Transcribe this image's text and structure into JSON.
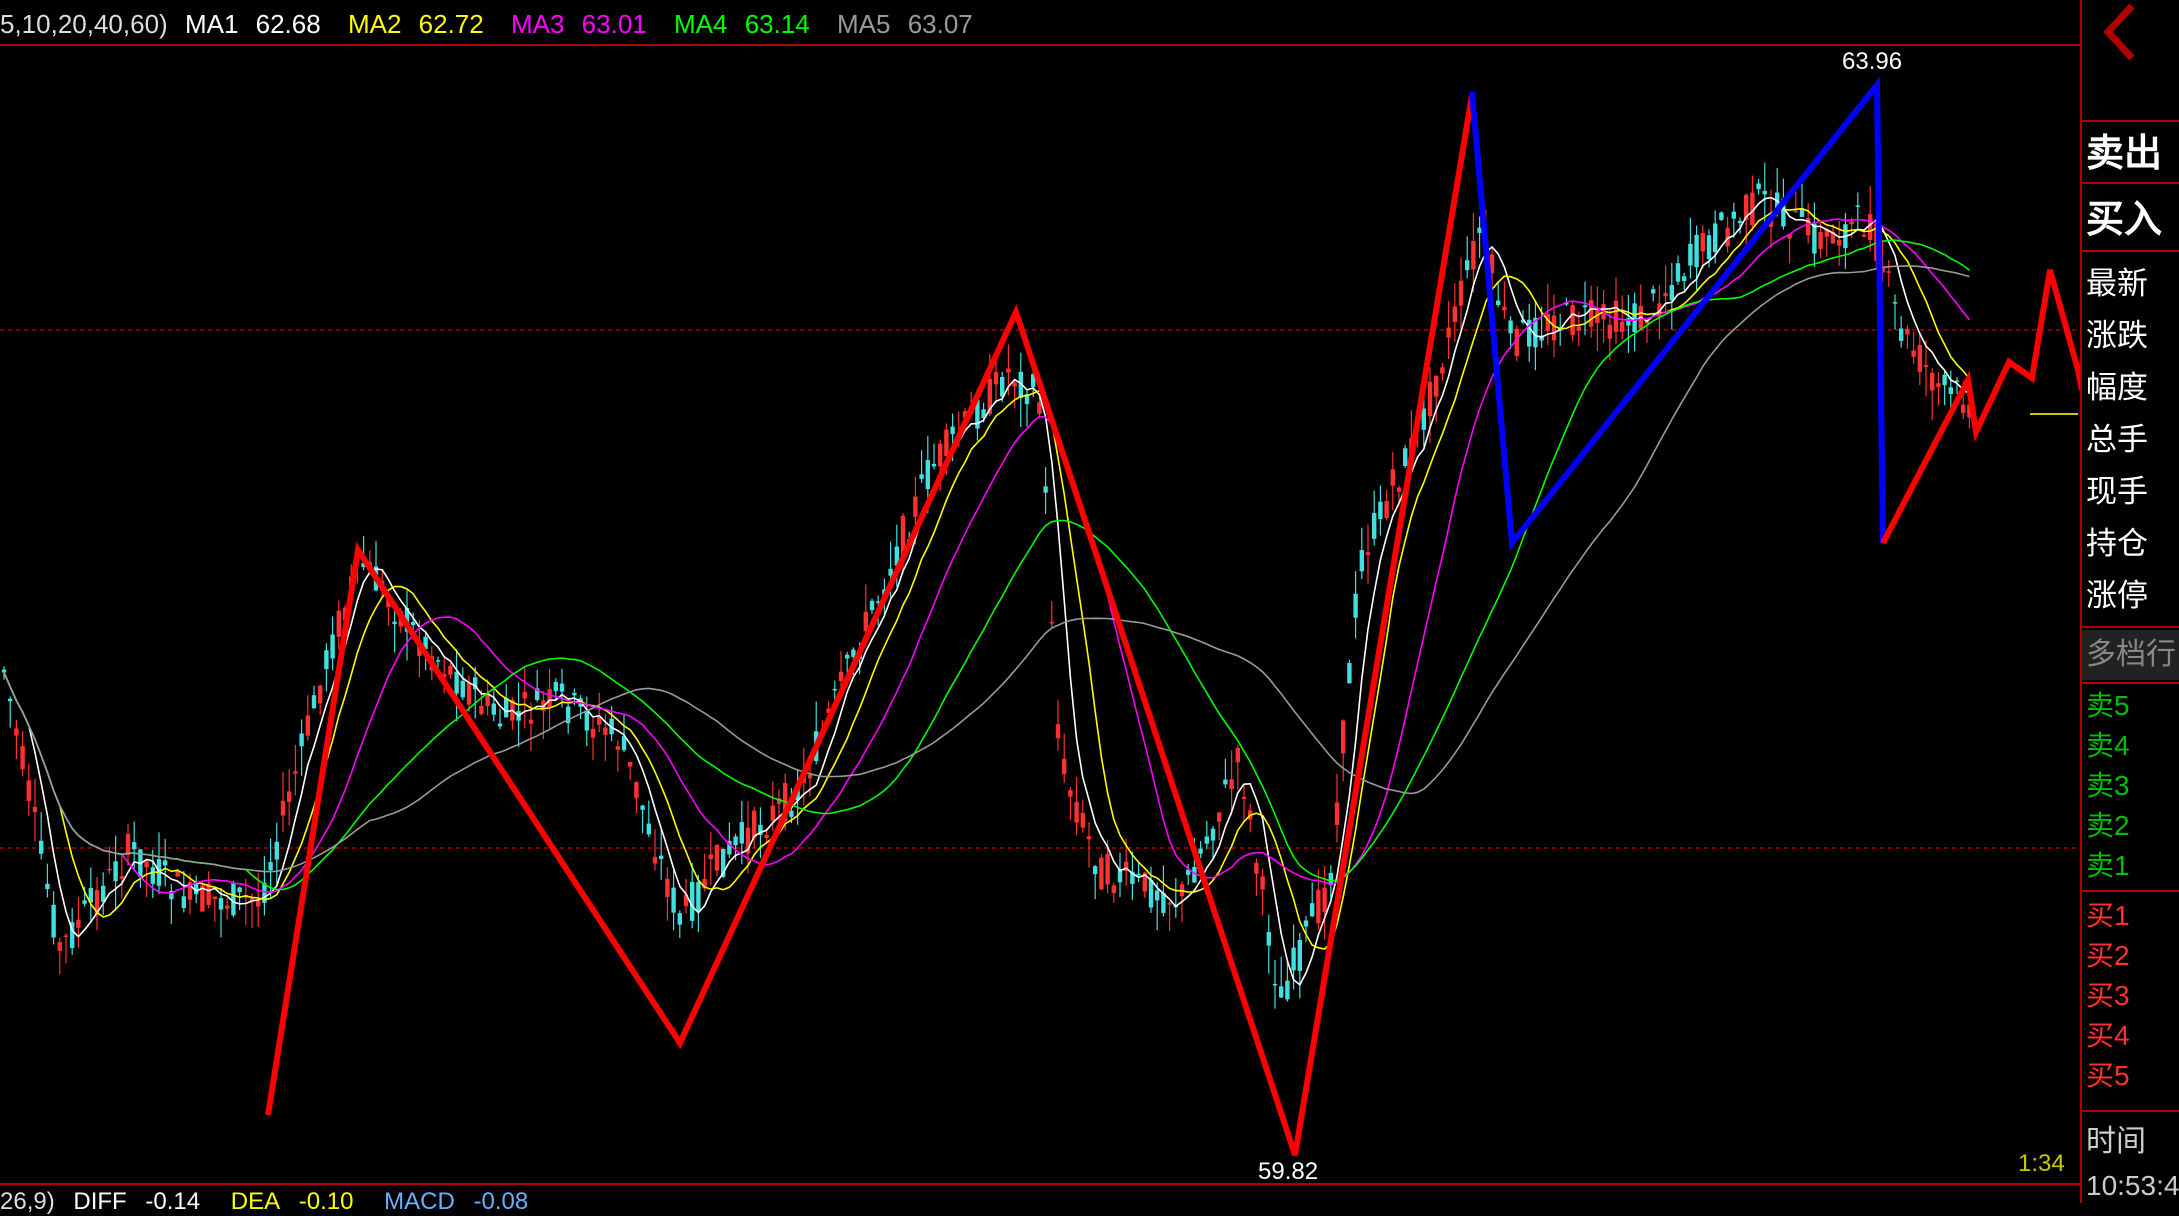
{
  "ma_indicator": {
    "params": "5,10,20,40,60)",
    "ma1": {
      "label": "MA1",
      "value": "62.68",
      "color": "#ffffff"
    },
    "ma2": {
      "label": "MA2",
      "value": "62.72",
      "color": "#ffff00"
    },
    "ma3": {
      "label": "MA3",
      "value": "63.01",
      "color": "#ff00ff"
    },
    "ma4": {
      "label": "MA4",
      "value": "63.14",
      "color": "#00ff00"
    },
    "ma5": {
      "label": "MA5",
      "value": "63.07",
      "color": "#9a9a9a"
    }
  },
  "price_marks": {
    "high": "63.96",
    "low": "59.82"
  },
  "macd_indicator": {
    "params": "26,9)",
    "diff": {
      "label": "DIFF",
      "value": "-0.14"
    },
    "dea": {
      "label": "DEA",
      "value": "-0.10"
    },
    "macd": {
      "label": "MACD",
      "value": "-0.08"
    }
  },
  "time_corner": "1:34",
  "side_panel": {
    "sell_button": "卖出",
    "buy_button": "买入",
    "fields": [
      "最新",
      "涨跌",
      "幅度",
      "总手",
      "现手",
      "持仓",
      "涨停"
    ],
    "multi_level": "多档行",
    "sell_levels": [
      "卖5",
      "卖4",
      "卖3",
      "卖2",
      "卖1"
    ],
    "buy_levels": [
      "买1",
      "买2",
      "买3",
      "买4",
      "买5"
    ],
    "time_label": "时间",
    "time_value": "10:53:4"
  },
  "colors": {
    "up_candle": "#ff3030",
    "down_candle": "#40e0e0",
    "zigzag_red": "#ff0000",
    "zigzag_blue": "#0000ff",
    "border_red": "#b00000"
  }
}
